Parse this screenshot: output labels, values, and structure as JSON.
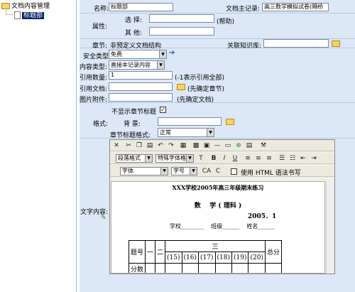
{
  "tree": {
    "root_label": "文档内容管理",
    "child_label": "标题部"
  },
  "form": {
    "name_label": "名称:",
    "name_value": "标题部",
    "master_label": "文档主记录:",
    "master_value": "高三数学模拟试卷(隔桥",
    "attr_label": "属性:",
    "choose_label": "选 择:",
    "choose_help": "(帮助)",
    "other_label": "其 他:",
    "chapter_label": "章节:",
    "chapter_value": "非预定义文档结构",
    "kb_label": "关联知识库:",
    "security_label": "安全类型",
    "security_value": "免费",
    "content_type_label": "内容类型:",
    "content_type_value": "直接本记录内容",
    "ref_count_label": "引用数量:",
    "ref_count_value": "1",
    "ref_count_hint": "(-1表示引用全部)",
    "ref_doc_label": "引用文档:",
    "ref_doc_hint": "(先确定章节)",
    "attach_label": "图片附件:",
    "attach_hint": "(先确定文档)",
    "hide_title_label": "不显示章节标题",
    "format_label": "格式:",
    "bg_label": "背 景:",
    "title_format_label": "章节标题格式:",
    "title_format_value": "正常",
    "content_label": "文字内容:"
  },
  "editor": {
    "para_format": "段落格式",
    "special_font": "特殊字体格式",
    "font": "字体",
    "font_size": "字号",
    "use_html": "使用 HTML 语法书写",
    "tool_ca": "CA",
    "tool_c": "C"
  },
  "doc": {
    "heading": "XXX学校2005年高三年级期末练习",
    "subject": "数    学 ( 理科 )",
    "date": "2005．1",
    "student_line": "学校________    班级______    姓名______",
    "table": {
      "header": [
        "题号",
        "一",
        "二",
        "三",
        "总分"
      ],
      "sub": [
        "(15)",
        "(16)",
        "(17)",
        "(18)",
        "(19)",
        "(20)"
      ],
      "score_label": "分数"
    }
  }
}
